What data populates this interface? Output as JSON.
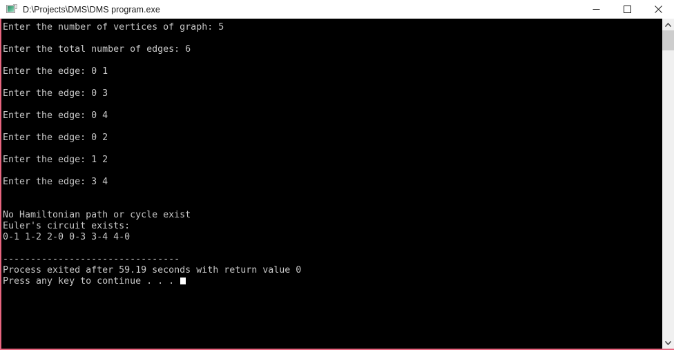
{
  "window": {
    "title": "D:\\Projects\\DMS\\DMS program.exe",
    "icon": "console-app-icon",
    "accent_border_color": "#e8657f",
    "controls": {
      "minimize_label": "Minimize",
      "maximize_label": "Maximize",
      "close_label": "Close"
    }
  },
  "console": {
    "background_color": "#000000",
    "text_color": "#c8c8c8",
    "cursor": "block",
    "lines": [
      "Enter the number of vertices of graph: 5",
      "",
      "Enter the total number of edges: 6",
      "",
      "Enter the edge: 0 1",
      "",
      "Enter the edge: 0 3",
      "",
      "Enter the edge: 0 4",
      "",
      "Enter the edge: 0 2",
      "",
      "Enter the edge: 1 2",
      "",
      "Enter the edge: 3 4",
      "",
      "",
      "No Hamiltonian path or cycle exist",
      "Euler's circuit exists:",
      "0-1 1-2 2-0 0-3 3-4 4-0",
      "",
      "--------------------------------",
      "Process exited after 59.19 seconds with return value 0"
    ],
    "final_line": "Press any key to continue . . . "
  },
  "scrollbar": {
    "up_arrow": "chevron-up-icon",
    "down_arrow": "chevron-down-icon",
    "thumb_position_percent": 0,
    "thumb_size_percent": 7
  }
}
